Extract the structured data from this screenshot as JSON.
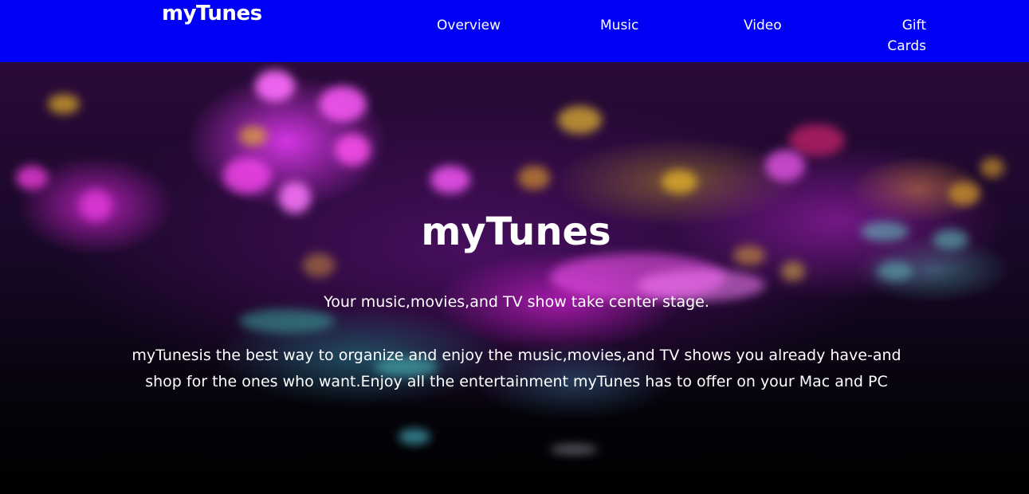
{
  "header": {
    "brand": "myTunes",
    "nav": {
      "overview": "Overview",
      "music": "Music",
      "video": "Video",
      "gift_cards": "Gift Cards"
    },
    "background_color": "#0000f7"
  },
  "hero": {
    "title": "myTunes",
    "tagline": "Your music,movies,and TV show take center stage.",
    "description": "myTunesis the best way to organize and enjoy the music,movies,and TV shows you already have-and shop for the ones who want.Enjoy all the entertainment myTunes has to offer on your Mac and PC"
  }
}
